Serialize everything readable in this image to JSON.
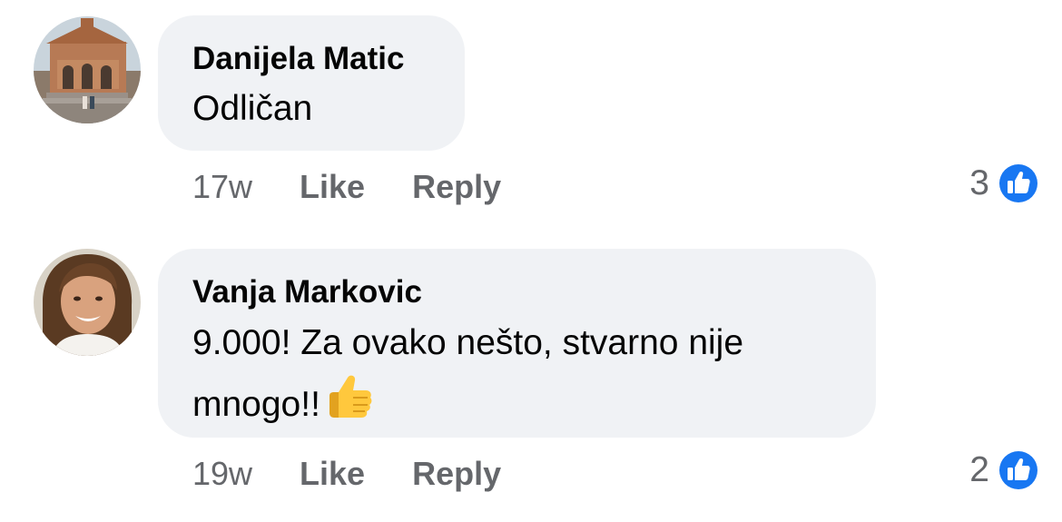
{
  "comments": [
    {
      "author": "Danijela Matic",
      "text": "Odličan",
      "time": "17w",
      "like_label": "Like",
      "reply_label": "Reply",
      "reaction_count": "3",
      "reaction_icon": "thumbs-up-icon",
      "avatar": "church-photo-avatar"
    },
    {
      "author": "Vanja Markovic",
      "text": "9.000! Za ovako nešto, stvarno nije mnogo!!",
      "emoji": "thumbs-up-emoji",
      "time": "19w",
      "like_label": "Like",
      "reply_label": "Reply",
      "reaction_count": "2",
      "reaction_icon": "thumbs-up-icon",
      "avatar": "woman-portrait-avatar"
    }
  ],
  "colors": {
    "bubble": "#f0f2f5",
    "meta_text": "#65676b",
    "like_blue": "#1877f2",
    "primary_text": "#050505"
  }
}
